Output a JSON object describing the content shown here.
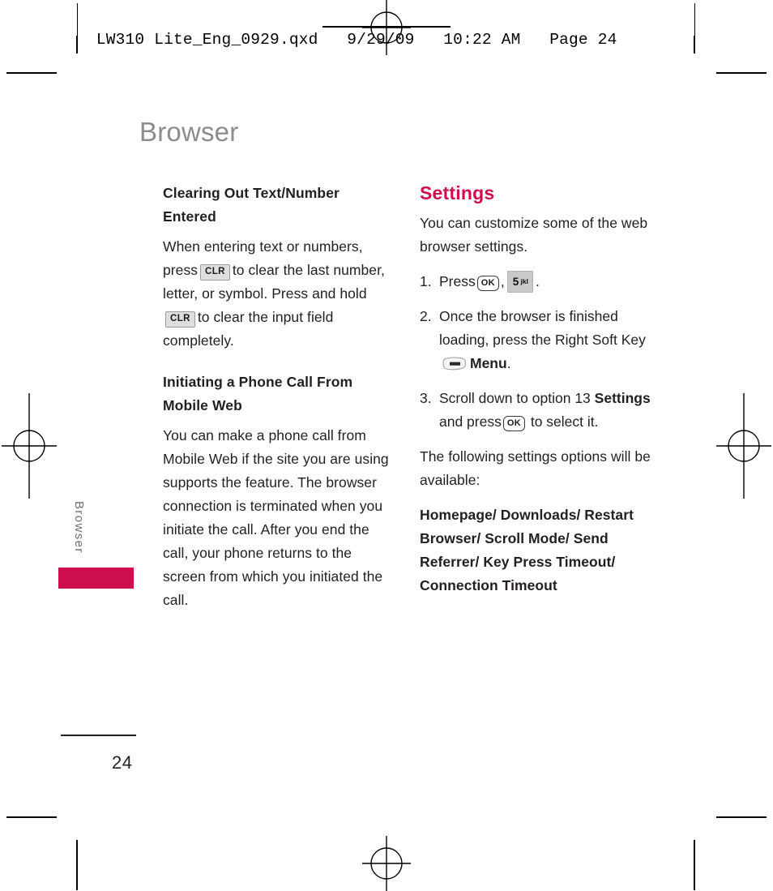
{
  "print_header": {
    "text": "LW310 Lite_Eng_0929.qxd   9/29/09   10:22 AM   Page 24"
  },
  "page": {
    "title": "Browser",
    "number": "24",
    "side_tab_label": "Browser",
    "accent_color": "#ce0e4e",
    "title_color": "#8c8c8c"
  },
  "left_column": {
    "section1": {
      "heading": "Clearing Out Text/Number Entered",
      "para_part1": "When entering text or numbers, press",
      "key1": "CLR",
      "para_part2": "to clear the last number, letter, or symbol. Press and hold",
      "key2": "CLR",
      "para_part3": "to clear the input field completely."
    },
    "section2": {
      "heading": "Initiating a Phone Call From Mobile Web",
      "para": "You can make a phone call from Mobile Web if the site you are using supports the feature. The browser connection is terminated when you initiate the call. After you end the call, your phone returns to the screen from which you initiated the call."
    }
  },
  "right_column": {
    "heading": "Settings",
    "intro": "You can customize some of the web browser settings.",
    "steps": [
      {
        "num": "1.",
        "text_before": "Press",
        "key_ok": "OK",
        "separator": ",",
        "key_num_digit": "5",
        "key_num_letters": "jkl",
        "text_after": "."
      },
      {
        "num": "2.",
        "text_before": "Once the browser is finished loading, press the Right Soft Key",
        "soft_key_icon": "soft-key-icon",
        "bold_text": "Menu",
        "text_after": "."
      },
      {
        "num": "3.",
        "text_before": "Scroll down to option 13",
        "bold_text": "Settings",
        "text_mid": "and press",
        "key_ok": "OK",
        "text_after": "to select it."
      }
    ],
    "outro": "The following settings options will be available:",
    "options_line": "Homepage/ Downloads/ Restart Browser/ Scroll Mode/ Send Referrer/ Key Press Timeout/ Connection Timeout"
  }
}
